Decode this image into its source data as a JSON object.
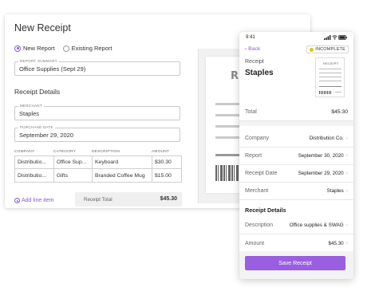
{
  "desktop": {
    "title": "New Receipt",
    "radio_options": [
      {
        "label": "New Report",
        "selected": true
      },
      {
        "label": "Existing Report",
        "selected": false
      }
    ],
    "report_summary": {
      "label": "REPORT SUMMARY",
      "value": "Office Supplies (Sept 29)"
    },
    "receipt_details_title": "Receipt Details",
    "merchant": {
      "label": "MERCHANT",
      "value": "Staples"
    },
    "purchase_date": {
      "label": "PURCHASE DATE",
      "value": "September 29, 2020"
    },
    "line_items": {
      "columns": [
        "COMPANY",
        "CATEGORY",
        "DESCRIPTION",
        "AMOUNT"
      ],
      "rows": [
        [
          "Distributio...",
          "Office Sup...",
          "Keyboard",
          "$30.30"
        ],
        [
          "Distributio...",
          "Gifts",
          "Branded Coffee Mug",
          "$15.00"
        ]
      ]
    },
    "add_line_item": "Add line item",
    "receipt_total_label": "Receipt Total",
    "receipt_total_value": "$45.30",
    "receipt_image_heading": "RE"
  },
  "mobile": {
    "status_time": "9:41",
    "status_icons": "signal-wifi-battery-icons",
    "back_label": "Back",
    "status_badge": "INCOMPLETE",
    "receipt_label": "Receipt",
    "vendor": "Staples",
    "thumb_title": "RECEIPT",
    "total_label": "Total",
    "total_value": "$45.30",
    "fields": [
      {
        "key": "Company",
        "value": "Distribution Co."
      },
      {
        "key": "Report",
        "value": "September 30, 2020"
      },
      {
        "key": "Receipt Date",
        "value": "September 29, 2020"
      },
      {
        "key": "Merchant",
        "value": "Staples"
      }
    ],
    "details_title": "Receipt Details",
    "detail_fields": [
      {
        "key": "Description",
        "value": "Office supplies & SWAG"
      },
      {
        "key": "Amount",
        "value": "$45.30"
      }
    ],
    "save_label": "Save Receipt"
  },
  "colors": {
    "accent": "#8d5bd6",
    "button": "#9a5ee0",
    "badge_dot": "#e6c500"
  }
}
